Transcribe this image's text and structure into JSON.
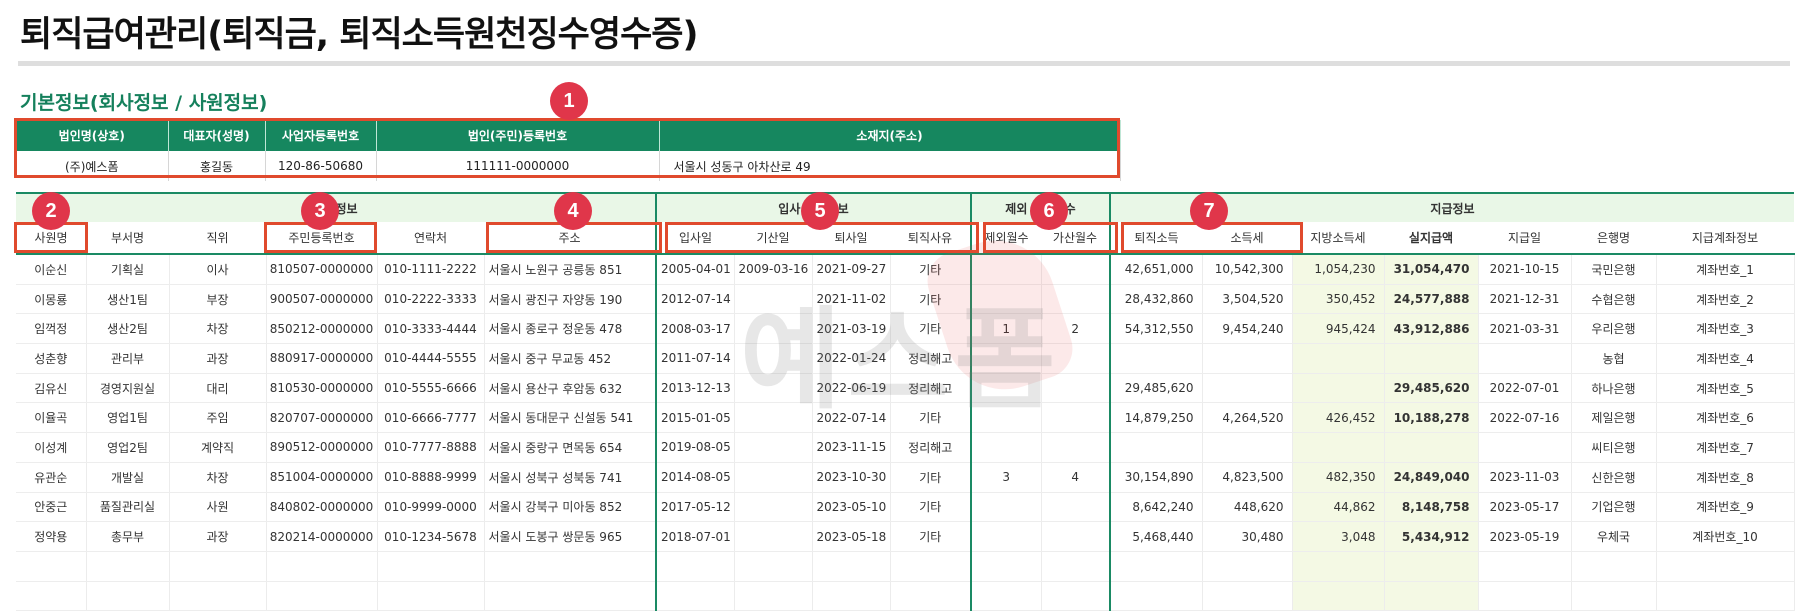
{
  "title": "퇴직급여관리(퇴직금, 퇴직소득원천징수영수증)",
  "section_title": "기본정보(회사정보 / 사원정보)",
  "company": {
    "headers": [
      "법인명(상호)",
      "대표자(성명)",
      "사업자등록번호",
      "법인(주민)등록번호",
      "소재지(주소)"
    ],
    "values": [
      "(주)예스폼",
      "홍길동",
      "120-86-50680",
      "111111-0000000",
      "서울시 성동구 아차산로 49"
    ]
  },
  "groups": {
    "employee": "사원정보",
    "join": "입사 퇴사정보",
    "months": "제외 가산월수",
    "pay": "지급정보"
  },
  "columns": [
    "사원명",
    "부서명",
    "직위",
    "주민등록번호",
    "연락처",
    "주소",
    "입사일",
    "기산일",
    "퇴사일",
    "퇴직사유",
    "제외월수",
    "가산월수",
    "퇴직소득",
    "소득세",
    "지방소득세",
    "실지급액",
    "지급일",
    "은행명",
    "지급계좌정보"
  ],
  "rows": [
    [
      "이순신",
      "기획실",
      "이사",
      "810507-0000000",
      "010-1111-2222",
      "서울시 노원구 공릉동 851",
      "2005-04-01",
      "2009-03-16",
      "2021-09-27",
      "기타",
      "",
      "",
      "42,651,000",
      "10,542,300",
      "1,054,230",
      "31,054,470",
      "2021-10-15",
      "국민은행",
      "계좌번호_1"
    ],
    [
      "이몽룡",
      "생산1팀",
      "부장",
      "900507-0000000",
      "010-2222-3333",
      "서울시 광진구 자양동 190",
      "2012-07-14",
      "",
      "2021-11-02",
      "기타",
      "",
      "",
      "28,432,860",
      "3,504,520",
      "350,452",
      "24,577,888",
      "2021-12-31",
      "수협은행",
      "계좌번호_2"
    ],
    [
      "임꺽정",
      "생산2팀",
      "차장",
      "850212-0000000",
      "010-3333-4444",
      "서울시 종로구 정운동 478",
      "2008-03-17",
      "",
      "2021-03-19",
      "기타",
      "1",
      "2",
      "54,312,550",
      "9,454,240",
      "945,424",
      "43,912,886",
      "2021-03-31",
      "우리은행",
      "계좌번호_3"
    ],
    [
      "성춘향",
      "관리부",
      "과장",
      "880917-0000000",
      "010-4444-5555",
      "서울시 중구 무교동 452",
      "2011-07-14",
      "",
      "2022-01-24",
      "정리해고",
      "",
      "",
      "",
      "",
      "",
      "",
      "",
      "농협",
      "계좌번호_4"
    ],
    [
      "김유신",
      "경영지원실",
      "대리",
      "810530-0000000",
      "010-5555-6666",
      "서울시 용산구 후암동 632",
      "2013-12-13",
      "",
      "2022-06-19",
      "정리해고",
      "",
      "",
      "29,485,620",
      "",
      "",
      "29,485,620",
      "2022-07-01",
      "하나은행",
      "계좌번호_5"
    ],
    [
      "이율곡",
      "영업1팀",
      "주임",
      "820707-0000000",
      "010-6666-7777",
      "서울시 동대문구 신설동 541",
      "2015-01-05",
      "",
      "2022-07-14",
      "기타",
      "",
      "",
      "14,879,250",
      "4,264,520",
      "426,452",
      "10,188,278",
      "2022-07-16",
      "제일은행",
      "계좌번호_6"
    ],
    [
      "이성계",
      "영업2팀",
      "계약직",
      "890512-0000000",
      "010-7777-8888",
      "서울시 중랑구 면목동 654",
      "2019-08-05",
      "",
      "2023-11-15",
      "정리해고",
      "",
      "",
      "",
      "",
      "",
      "",
      "",
      "씨티은행",
      "계좌번호_7"
    ],
    [
      "유관순",
      "개발실",
      "차장",
      "851004-0000000",
      "010-8888-9999",
      "서울시 성북구 성북동 741",
      "2014-08-05",
      "",
      "2023-10-30",
      "기타",
      "3",
      "4",
      "30,154,890",
      "4,823,500",
      "482,350",
      "24,849,040",
      "2023-11-03",
      "신한은행",
      "계좌번호_8"
    ],
    [
      "안중근",
      "품질관리실",
      "사원",
      "840802-0000000",
      "010-9999-0000",
      "서울시 강북구 미아동 852",
      "2017-05-12",
      "",
      "2023-05-10",
      "기타",
      "",
      "",
      "8,642,240",
      "448,620",
      "44,862",
      "8,148,758",
      "2023-05-17",
      "기업은행",
      "계좌번호_9"
    ],
    [
      "정약용",
      "총무부",
      "과장",
      "820214-0000000",
      "010-1234-5678",
      "서울시 도봉구 쌍문동 965",
      "2018-07-01",
      "",
      "2023-05-18",
      "기타",
      "",
      "",
      "5,468,440",
      "30,480",
      "3,048",
      "5,434,912",
      "2023-05-19",
      "우체국",
      "계좌번호_10"
    ]
  ],
  "badges": [
    "1",
    "2",
    "3",
    "4",
    "5",
    "6",
    "7"
  ],
  "watermark": "예스폼",
  "colors": {
    "accent": "#16875f",
    "highlight": "#e04a2d",
    "badge": "#e0364a",
    "excluded": "#e03b2d",
    "added": "#1e88d6"
  }
}
